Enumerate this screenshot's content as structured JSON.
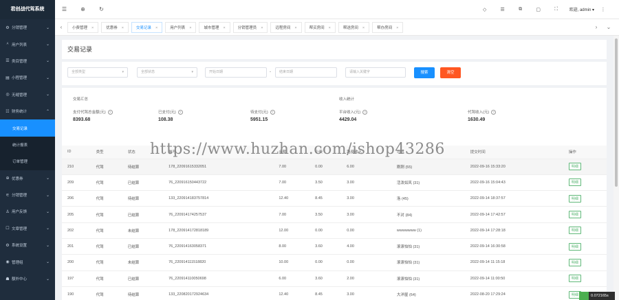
{
  "app": {
    "title": "君创战代驾系统"
  },
  "sidebar": {
    "items": [
      {
        "icon": "⚙",
        "icon_name": "gear-icon",
        "label": "分销管理"
      },
      {
        "icon": "ᴬ",
        "icon_name": "user-icon",
        "label": "用户列表"
      },
      {
        "icon": "☰",
        "icon_name": "list-icon",
        "label": "类目管理"
      },
      {
        "icon": "▤",
        "icon_name": "mini-icon",
        "label": "小程管理"
      },
      {
        "icon": "◎",
        "icon_name": "settings-icon",
        "label": "无缝管理"
      },
      {
        "icon": "☷",
        "icon_name": "finance-icon",
        "label": "财务统计"
      }
    ],
    "subitems": [
      {
        "label": "交易记录"
      },
      {
        "label": "统计报表"
      },
      {
        "label": "订单管理"
      }
    ],
    "items_after": [
      {
        "icon": "⊕",
        "icon_name": "coupon-icon",
        "label": "优惠券"
      },
      {
        "icon": "⚟",
        "icon_name": "share-icon",
        "label": "分销管理"
      },
      {
        "icon": "♙",
        "icon_name": "feedback-icon",
        "label": "用户反馈"
      },
      {
        "icon": "☐",
        "icon_name": "article-icon",
        "label": "文章管理"
      },
      {
        "icon": "⚙",
        "icon_name": "system-icon",
        "label": "系统设置"
      },
      {
        "icon": "◉",
        "icon_name": "admin-icon",
        "label": "管理组"
      },
      {
        "icon": "☗",
        "icon_name": "home-icon",
        "label": "额外中心"
      }
    ]
  },
  "header": {
    "welcome": "欢迎, admin ▾"
  },
  "tabs": [
    {
      "label": "小费管理"
    },
    {
      "label": "优惠券"
    },
    {
      "label": "交易记录"
    },
    {
      "label": "用户列表"
    },
    {
      "label": "城市管理"
    },
    {
      "label": "分销管理员"
    },
    {
      "label": "远程房间"
    },
    {
      "label": "帮买房间"
    },
    {
      "label": "帮送房间"
    },
    {
      "label": "帮办房间"
    }
  ],
  "page": {
    "title": "交易记录"
  },
  "filter": {
    "type_placeholder": "全部类型",
    "status_placeholder": "全部状态",
    "start_placeholder": "开始日期",
    "dash": "-",
    "end_placeholder": "结束日期",
    "keyword_placeholder": "请输入关键字",
    "search_label": "搜索",
    "reset_label": "清空"
  },
  "summary": {
    "left_title": "交易汇总",
    "right_title": "收入统计",
    "stats": [
      {
        "label": "支付代驾总金额(元)",
        "value": "8393.68"
      },
      {
        "label": "已支付(元)",
        "value": "108.38"
      },
      {
        "label": "待支付(元)",
        "value": "5951.15"
      },
      {
        "label": "平台收入(元)",
        "value": "4429.04"
      },
      {
        "label": "代驾收入(元)",
        "value": "1630.49"
      }
    ]
  },
  "table": {
    "headers": [
      "ID",
      "类型",
      "状态",
      "单号",
      "金额",
      "小费",
      "路费收入",
      "司机",
      "提交时间",
      "操作"
    ],
    "rows": [
      [
        "210",
        "代驾",
        "待结算",
        "178_22091615332051",
        "7.00",
        "0.00",
        "6.00",
        "刚刚 (55)",
        "2022-09-16 15:33:20",
        "明细"
      ],
      [
        "209",
        "代驾",
        "已结算",
        "76_220916150443722",
        "7.00",
        "3.50",
        "3.00",
        "活泼如风 (31)",
        "2022-09-16 15:04:43",
        "明细"
      ],
      [
        "206",
        "代驾",
        "待结算",
        "133_220914183757814",
        "12.40",
        "8.45",
        "3.00",
        "洛 (45)",
        "2022-09-14 18:37:57",
        "明细"
      ],
      [
        "205",
        "代驾",
        "已结算",
        "76_220914174257537",
        "7.00",
        "3.50",
        "3.00",
        "不对 (84)",
        "2022-09-14 17:42:57",
        "明细"
      ],
      [
        "202",
        "代驾",
        "未结算",
        "178_220914172818189",
        "12.00",
        "0.00",
        "0.00",
        "wwwwwww (1)",
        "2022-09-14 17:28:18",
        "明细"
      ],
      [
        "201",
        "代驾",
        "已结算",
        "76_220914163058371",
        "8.00",
        "3.60",
        "4.00",
        "滚滚怕怕 (31)",
        "2022-09-14 16:30:58",
        "明细"
      ],
      [
        "200",
        "代驾",
        "未结算",
        "76_220914111518820",
        "10.00",
        "0.00",
        "0.00",
        "滚滚怕怕 (31)",
        "2022-09-14 11:15:18",
        "明细"
      ],
      [
        "197",
        "代驾",
        "已结算",
        "76_220914110050698",
        "6.00",
        "3.60",
        "2.00",
        "滚滚怕怕 (31)",
        "2022-09-14 11:00:50",
        "明细"
      ],
      [
        "190",
        "代驾",
        "待结算",
        "133_220820172924634",
        "12.40",
        "8.45",
        "3.00",
        "大洋屋 (64)",
        "2022-08-20 17:29:24",
        "明细"
      ]
    ]
  },
  "watermark": "https://www.huzhan.com/ishop43286",
  "speed_badge": "0.072165s"
}
